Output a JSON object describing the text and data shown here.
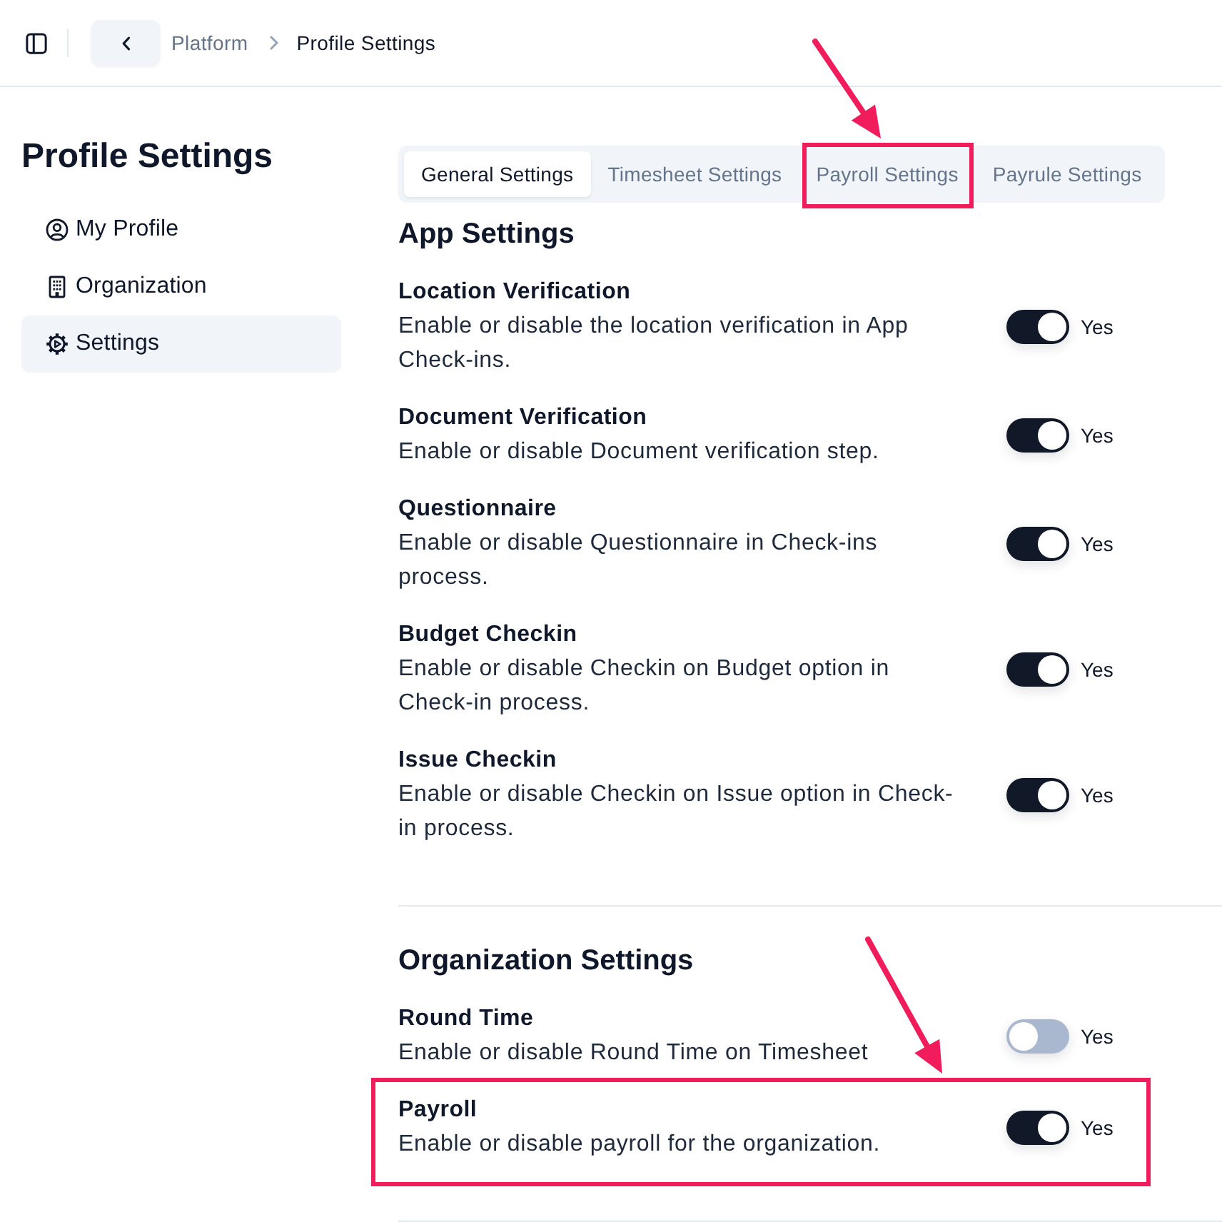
{
  "top_bar": {
    "breadcrumb": [
      {
        "label": "Platform",
        "current": false
      },
      {
        "label": "Profile Settings",
        "current": true
      }
    ]
  },
  "sidebar": {
    "title": "Profile Settings",
    "items": [
      {
        "kind": "profile",
        "label": "My Profile",
        "selected": false
      },
      {
        "kind": "organization",
        "label": "Organization",
        "selected": false
      },
      {
        "kind": "settings",
        "label": "Settings",
        "selected": true
      }
    ]
  },
  "tabs": [
    {
      "label": "General Settings",
      "selected": true,
      "highlighted": false
    },
    {
      "label": "Timesheet Settings",
      "selected": false,
      "highlighted": false
    },
    {
      "label": "Payroll Settings",
      "selected": false,
      "highlighted": true
    },
    {
      "label": "Payrule Settings",
      "selected": false,
      "highlighted": false
    }
  ],
  "sections": [
    {
      "title": "App Settings",
      "items": [
        {
          "title": "Location Verification",
          "description": "Enable or disable the location verification in App Check-ins.",
          "on": true,
          "value": "Yes",
          "highlighted": false
        },
        {
          "title": "Document Verification",
          "description": "Enable or disable Document verification step.",
          "on": true,
          "value": "Yes",
          "highlighted": false
        },
        {
          "title": "Questionnaire",
          "description": "Enable or disable Questionnaire in Check-ins process.",
          "on": true,
          "value": "Yes",
          "highlighted": false
        },
        {
          "title": "Budget Checkin",
          "description": "Enable or disable Checkin on Budget option in Check-in process.",
          "on": true,
          "value": "Yes",
          "highlighted": false
        },
        {
          "title": "Issue Checkin",
          "description": "Enable or disable Checkin on Issue option in Check-in process.",
          "on": true,
          "value": "Yes",
          "highlighted": false
        }
      ]
    },
    {
      "title": "Organization Settings",
      "items": [
        {
          "title": "Round Time",
          "description": "Enable or disable Round Time on Timesheet",
          "on": false,
          "value": "Yes",
          "highlighted": false
        },
        {
          "title": "Payroll",
          "description": "Enable or disable payroll for the organization.",
          "on": true,
          "value": "Yes",
          "highlighted": true
        }
      ]
    }
  ]
}
